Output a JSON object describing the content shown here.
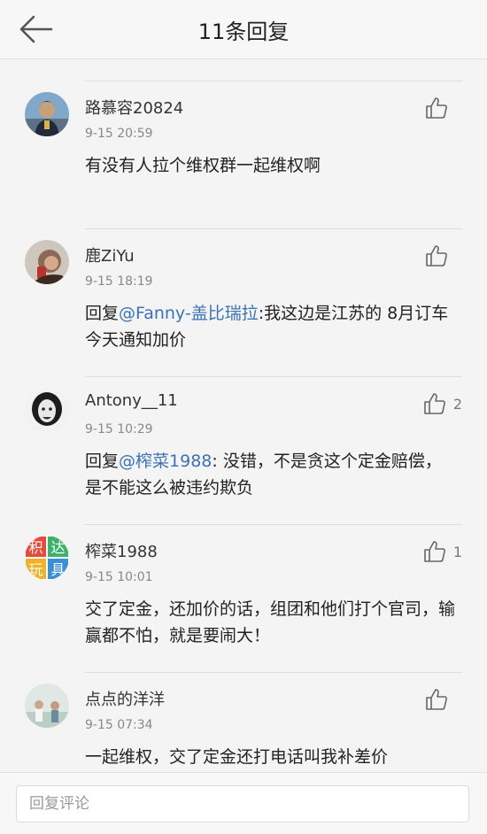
{
  "header": {
    "title": "11条回复"
  },
  "comments": [
    {
      "user": "路慕容20824",
      "time": "9-15 20:59",
      "prefix": "",
      "mention": "",
      "text": "有没有人拉个维权群一起维权啊",
      "likes": ""
    },
    {
      "user": "鹿ZiYu",
      "time": "9-15 18:19",
      "prefix": "回复",
      "mention": "@Fanny-盖比瑞拉",
      "text": ":我这边是江苏的  8月订车今天通知加价",
      "likes": ""
    },
    {
      "user": "Antony__11",
      "time": "9-15 10:29",
      "prefix": "回复",
      "mention": "@榨菜1988",
      "text": ": 没错，不是贪这个定金赔偿，是不能这么被违约欺负",
      "likes": "2"
    },
    {
      "user": "榨菜1988",
      "time": "9-15 10:01",
      "prefix": "",
      "mention": "",
      "text": "交了定金，还加价的话，组团和他们打个官司，输赢都不怕，就是要闹大！",
      "likes": "1"
    },
    {
      "user": "点点的洋洋",
      "time": "9-15 07:34",
      "prefix": "",
      "mention": "",
      "text": "一起维权，交了定金还打电话叫我补差价",
      "likes": ""
    }
  ],
  "avatar3_text": [
    "积",
    "达",
    "玩",
    "具"
  ],
  "bottom": {
    "placeholder": "回复评论"
  }
}
